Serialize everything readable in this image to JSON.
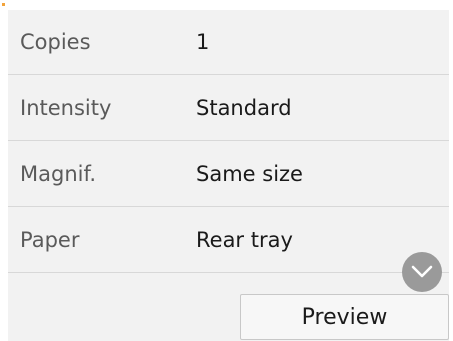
{
  "settings": {
    "rows": [
      {
        "label": "Copies",
        "value": "1"
      },
      {
        "label": "Intensity",
        "value": "Standard"
      },
      {
        "label": "Magnif.",
        "value": "Same size"
      },
      {
        "label": "Paper",
        "value": "Rear tray"
      }
    ]
  },
  "actions": {
    "preview_label": "Preview"
  },
  "icons": {
    "scroll_down": "chevron-down-icon"
  },
  "colors": {
    "panel_background": "#f2f2f2",
    "scroll_button": "#9a9a9a"
  }
}
